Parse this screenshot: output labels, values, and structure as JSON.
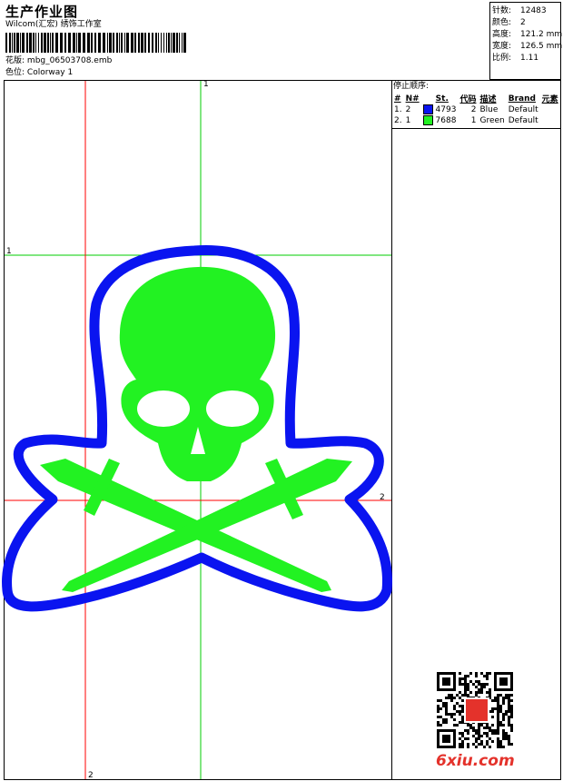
{
  "header": {
    "title": "生产作业图",
    "company": "Wilcom(汇宏) 绣饰工作室",
    "design_label": "花版:",
    "design_file": "mbg_06503708.emb",
    "color_label": "色位:",
    "colorway": "Colorway 1"
  },
  "stats": [
    {
      "label": "针数:",
      "value": "12483"
    },
    {
      "label": "颜色:",
      "value": "2"
    },
    {
      "label": "高度:",
      "value": "121.2 mm"
    },
    {
      "label": "宽度:",
      "value": "126.5 mm"
    },
    {
      "label": "比例:",
      "value": "1.11"
    }
  ],
  "stop_sequence": {
    "title": "停止顺序:",
    "columns": [
      "#",
      "N#",
      "St.",
      "代码",
      "描述",
      "Brand",
      "元素"
    ],
    "rows": [
      {
        "num": "1.",
        "n": "2",
        "stitches": "4793",
        "code": "2",
        "desc": "Blue",
        "brand": "Default",
        "color": "#0a14f0"
      },
      {
        "num": "2.",
        "n": "1",
        "stitches": "7688",
        "code": "1",
        "desc": "Green",
        "brand": "Default",
        "color": "#22f222"
      }
    ]
  },
  "guides": {
    "top": "1",
    "left": "1",
    "right": "2",
    "bottom": "2"
  },
  "artwork": {
    "outline_color": "#0a14f0",
    "fill_color": "#22f222",
    "guide_green": "#00cc00",
    "guide_red": "#ff0000"
  },
  "watermark": "6xiu.com"
}
